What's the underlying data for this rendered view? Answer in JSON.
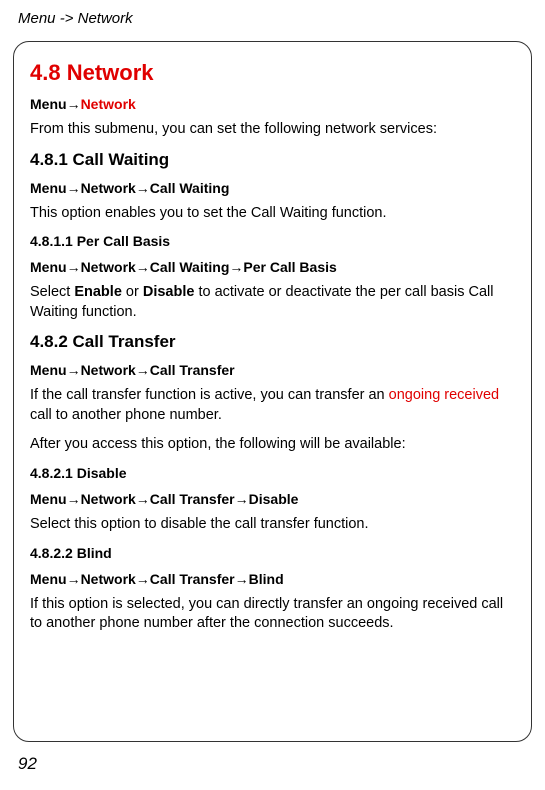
{
  "header": {
    "breadcrumb": "Menu -> Network"
  },
  "section": {
    "title": "4.8 Network",
    "menu_prefix": "Menu",
    "arrow": "→",
    "network_label": "Network",
    "intro_text": "From this submenu, you can set the following network services:"
  },
  "call_waiting": {
    "heading": "4.8.1 Call Waiting",
    "path_prefix": "Menu",
    "path_network": "Network",
    "path_suffix": "Call Waiting",
    "desc": "This option enables you to set the Call Waiting function.",
    "per_call": {
      "heading": "4.8.1.1 Per Call Basis",
      "path_prefix": "Menu",
      "path_network": "Network",
      "path_callwaiting": "Call Waiting",
      "path_suffix": "Per Call Basis",
      "desc_prefix": "Select ",
      "enable": "Enable",
      "desc_or": " or ",
      "disable": "Disable",
      "desc_suffix": " to activate or deactivate the per call basis Call Waiting function."
    }
  },
  "call_transfer": {
    "heading": "4.8.2 Call Transfer",
    "path_prefix": "Menu",
    "path_network": "Network",
    "path_suffix": "Call Transfer",
    "desc_prefix": "If the call transfer function is active, you can transfer an ",
    "desc_highlight": "ongoing received",
    "desc_suffix": " call to another phone number.",
    "desc2": "After you access this option, the following will be available:",
    "disable": {
      "heading": "4.8.2.1 Disable",
      "path_prefix": "Menu",
      "path_network": "Network",
      "path_ct": "Call Transfer",
      "path_suffix": "Disable",
      "desc": "Select this option to disable the call transfer function."
    },
    "blind": {
      "heading": "4.8.2.2 Blind",
      "path_prefix": "Menu",
      "path_network": "Network",
      "path_ct": "Call Transfer",
      "path_suffix": "Blind",
      "desc": "If this option is selected, you can directly transfer an ongoing received call to another phone number after the connection succeeds."
    }
  },
  "page_number": "92",
  "arrow_glyph": "→"
}
